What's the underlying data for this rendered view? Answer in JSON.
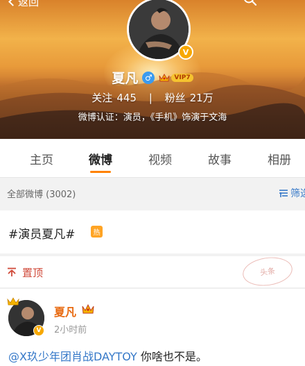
{
  "header": {
    "back_label": "返回",
    "icons": {
      "back": "chevron-left-icon",
      "search": "search-icon"
    }
  },
  "profile": {
    "name": "夏凡",
    "gender_symbol": "♂",
    "vip_label": "VIP7",
    "verified_symbol": "V",
    "follow_label": "关注",
    "follow_count": "445",
    "separator": "|",
    "fans_label": "粉丝",
    "fans_count": "21万",
    "verification": "微博认证：演员，《手机》饰演于文海"
  },
  "tabs": [
    {
      "label": "主页",
      "active": false
    },
    {
      "label": "微博",
      "active": true
    },
    {
      "label": "视频",
      "active": false
    },
    {
      "label": "故事",
      "active": false
    },
    {
      "label": "相册",
      "active": false
    }
  ],
  "feed": {
    "all_label": "全部微博 (3002)",
    "filter_label": "筛选",
    "topic": "#演员夏凡#",
    "hot_label": "热",
    "pinned_label": "置顶",
    "stamp_text": "头条"
  },
  "post": {
    "author": "夏凡",
    "time": "2小时前",
    "mention": "@X玖少年团肖战DAYTOY",
    "text": " 你啥也不是。"
  },
  "colors": {
    "accent": "#ff8200",
    "link": "#3578c8",
    "pinned": "#d04a3a",
    "author": "#e86a10"
  }
}
